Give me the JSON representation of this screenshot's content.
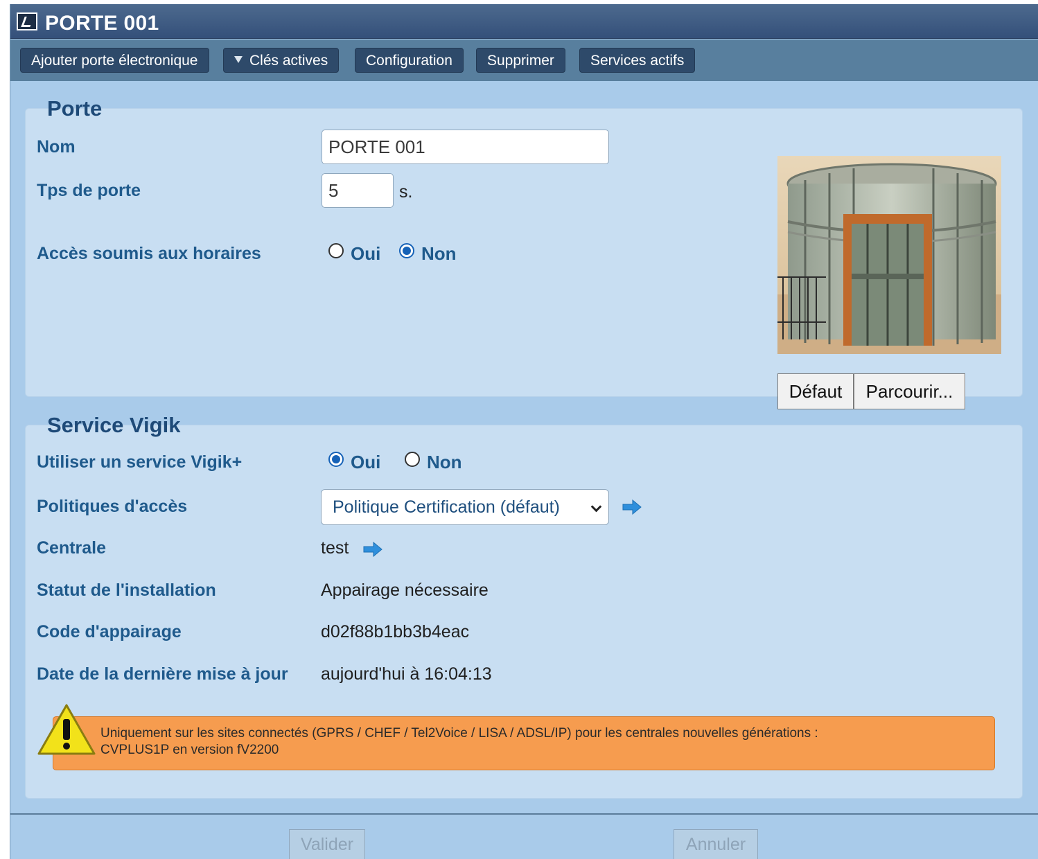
{
  "window": {
    "title": "PORTE 001"
  },
  "toolbar": {
    "add_door": "Ajouter porte électronique",
    "active_keys": "Clés actives",
    "configuration": "Configuration",
    "delete": "Supprimer",
    "active_services": "Services actifs"
  },
  "porte": {
    "legend": "Porte",
    "name_label": "Nom",
    "name_value": "PORTE 001",
    "door_time_label": "Tps de porte",
    "door_time_value": "5",
    "door_time_unit": "s.",
    "schedule_label": "Accès soumis aux horaires",
    "schedule_yes": "Oui",
    "schedule_no": "Non",
    "schedule_selected": "Non",
    "default_button": "Défaut",
    "browse_button": "Parcourir..."
  },
  "vigik": {
    "legend": "Service Vigik",
    "use_label": "Utiliser un service Vigik+",
    "use_yes": "Oui",
    "use_no": "Non",
    "use_selected": "Oui",
    "policy_label": "Politiques d'accès",
    "policy_value": "Politique Certification (défaut)",
    "central_label": "Centrale",
    "central_value": "test",
    "status_label": "Statut de l'installation",
    "status_value": "Appairage nécessaire",
    "pairing_label": "Code d'appairage",
    "pairing_value": "d02f88b1bb3b4eac",
    "last_update_label": "Date de la dernière mise à jour",
    "last_update_value": "aujourd'hui à 16:04:13",
    "warning_line1": "Uniquement sur les sites connectés (GPRS / CHEF / Tel2Voice / LISA / ADSL/IP) pour les centrales nouvelles générations :",
    "warning_line2": "CVPLUS1P en version fV2200"
  },
  "footer": {
    "validate": "Valider",
    "cancel": "Annuler"
  },
  "colors": {
    "accent": "#1f5a8c",
    "warning": "#f69c4f",
    "toolbar": "#587f9e"
  }
}
